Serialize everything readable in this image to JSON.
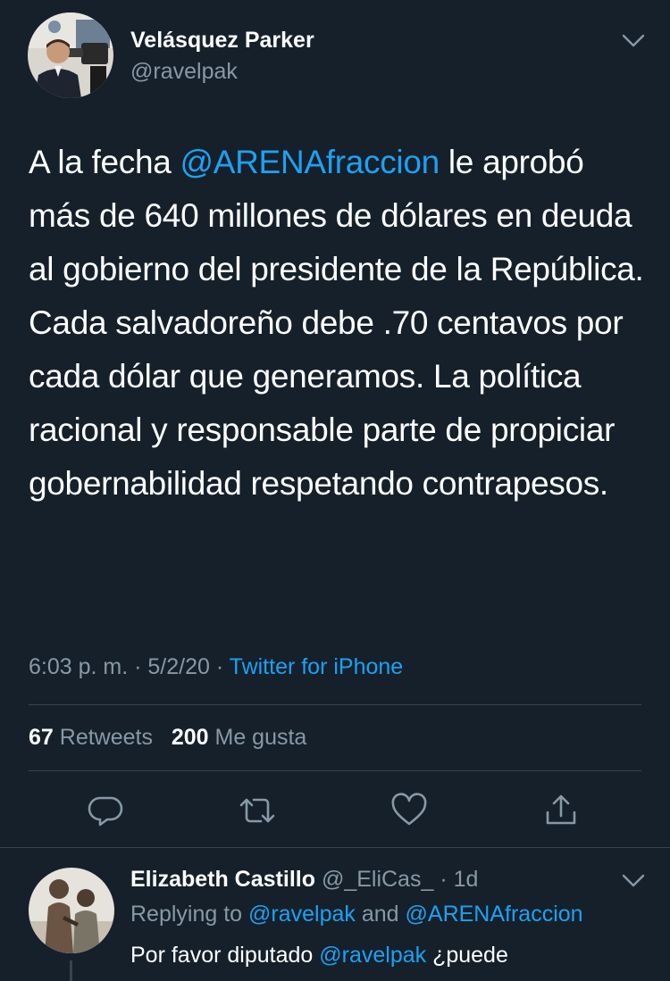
{
  "tweet": {
    "author_name": "Velásquez Parker",
    "author_handle": "@ravelpak",
    "text_1": "A la fecha ",
    "mention": "@ARENAfraccion",
    "text_2": " le aprobó más de 640 millones de dólares en deuda al gobierno del presidente de la República. Cada salvadoreño debe .70 centavos por cada dólar que generamos. La política racional y responsable parte de propiciar gobernabilidad respetando contrapesos.",
    "time": "6:03 p. m.",
    "sep1": " · ",
    "date": "5/2/20",
    "sep2": " · ",
    "source": "Twitter for iPhone",
    "retweets_count": "67",
    "retweets_label": "Retweets",
    "likes_count": "200",
    "likes_label": "Me gusta"
  },
  "icons": {
    "reply": "speech-bubble-icon",
    "retweet": "retweet-arrows-icon",
    "like": "heart-icon",
    "share": "share-upload-icon",
    "menu": "chevron-down-icon"
  },
  "reply": {
    "author_name": "Elizabeth Castillo",
    "author_handle": "@_EliCas_",
    "sep": " · ",
    "age": "1d",
    "replying_to_label": "Replying to ",
    "replying_to_1": "@ravelpak",
    "and_label": " and ",
    "replying_to_2": "@ARENAfraccion",
    "text_1": "Por favor diputado ",
    "mention": "@ravelpak",
    "text_2": " ¿puede"
  },
  "colors": {
    "background": "#15202b",
    "accent": "#1da1f2",
    "secondary_text": "#8899a6",
    "divider": "#38444d"
  }
}
